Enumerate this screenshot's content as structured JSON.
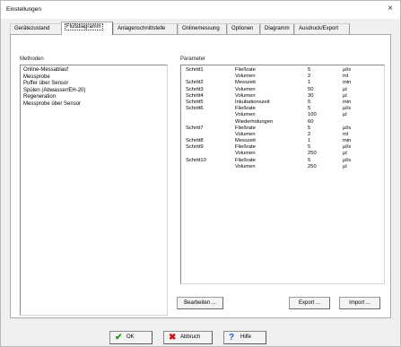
{
  "window": {
    "title": "Einstellungen",
    "close_glyph": "×"
  },
  "tabs": [
    {
      "label": "Gerätezustand",
      "active": false
    },
    {
      "label": "Flußdiagramm",
      "active": true
    },
    {
      "label": "Anlagenschnittstelle",
      "active": false
    },
    {
      "label": "Onlinemessung",
      "active": false
    },
    {
      "label": "Optionen",
      "active": false
    },
    {
      "label": "Diagramm",
      "active": false
    },
    {
      "label": "Ausdruck/Export",
      "active": false
    }
  ],
  "methods": {
    "label": "Methoden",
    "items": [
      "Online-Messablauf",
      "Messprobe",
      "Puffer über Sensor",
      "Spülen (Abwasser/EH-20)",
      "Regeneration",
      "Messprobe über Sensor"
    ]
  },
  "parameters": {
    "label": "Parameter",
    "rows": [
      [
        "Schritt1",
        "Fließrate",
        "5",
        "µl/s"
      ],
      [
        "",
        "Volumen",
        "2",
        "ml"
      ],
      [
        "Schritt2",
        "Messzeit",
        "1",
        "min"
      ],
      [
        "Schritt3",
        "Volumen",
        "50",
        "µl"
      ],
      [
        "Schritt4",
        "Volumen",
        "30",
        "µl"
      ],
      [
        "Schritt5",
        "Inkubationszeit",
        "5",
        "min"
      ],
      [
        "Schritt6",
        "Fließrate",
        "5",
        "µl/s"
      ],
      [
        "",
        "Volumen",
        "100",
        "µl"
      ],
      [
        "",
        "Wiederholungen",
        "60",
        ""
      ],
      [
        "Schritt7",
        "Fließrate",
        "5",
        "µl/s"
      ],
      [
        "",
        "Volumen",
        "2",
        "ml"
      ],
      [
        "Schritt8",
        "Messzeit",
        "1",
        "min"
      ],
      [
        "Schritt9",
        "Fließrate",
        "5",
        "µl/s"
      ],
      [
        "",
        "Volumen",
        "250",
        "µl"
      ],
      [
        "Schritt10",
        "Fließrate",
        "5",
        "µl/s"
      ],
      [
        "",
        "Volumen",
        "250",
        "µl"
      ]
    ]
  },
  "buttons": {
    "edit": "Bearbeiten ...",
    "export": "Export ...",
    "import": "Import ..."
  },
  "footer": {
    "ok": "OK",
    "cancel": "Abbruch",
    "help": "Hilfe"
  },
  "icons": {
    "ok": "check-icon",
    "cancel": "x-icon",
    "help": "question-icon"
  },
  "colors": {
    "ok_icon": "#1a9a1a",
    "cancel_icon": "#cc1111",
    "help_icon": "#1f5fd0"
  }
}
